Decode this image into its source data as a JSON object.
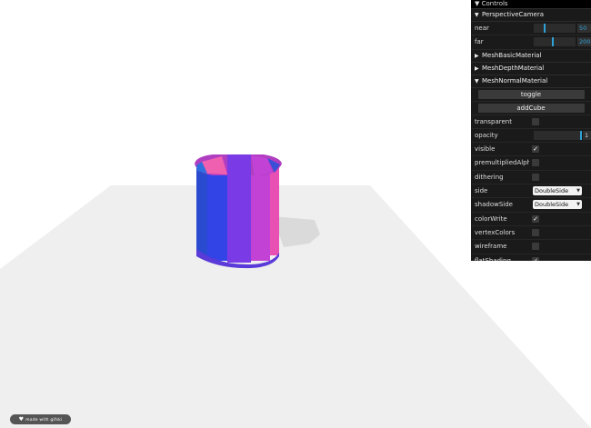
{
  "gui": {
    "title": "Controls",
    "camera_folder": "PerspectiveCamera",
    "near": {
      "label": "near",
      "value": "50"
    },
    "far": {
      "label": "far",
      "value": "200"
    },
    "folders": [
      "MeshBasicMaterial",
      "MeshDepthMaterial",
      "MeshNormalMaterial"
    ],
    "buttons": [
      "toggle",
      "addCube"
    ],
    "props": [
      {
        "label": "transparent",
        "checked": false
      },
      {
        "label": "opacity",
        "value": "1"
      },
      {
        "label": "visible",
        "checked": true
      },
      {
        "label": "premultipliedAlpha",
        "checked": false
      },
      {
        "label": "dithering",
        "checked": false
      },
      {
        "label": "side",
        "select": "DoubleSide"
      },
      {
        "label": "shadowSide",
        "select": "DoubleSide"
      },
      {
        "label": "colorWrite",
        "checked": true
      },
      {
        "label": "vertexColors",
        "checked": false
      },
      {
        "label": "wireframe",
        "checked": false
      },
      {
        "label": "flatShading",
        "checked": true
      }
    ]
  },
  "badge": {
    "text": "made with gifski",
    "icon": "heart-logo-icon"
  },
  "colors": {
    "gui_bg": "#1a1a1a",
    "accent": "#2fa1d6",
    "plane": "#efefef"
  }
}
